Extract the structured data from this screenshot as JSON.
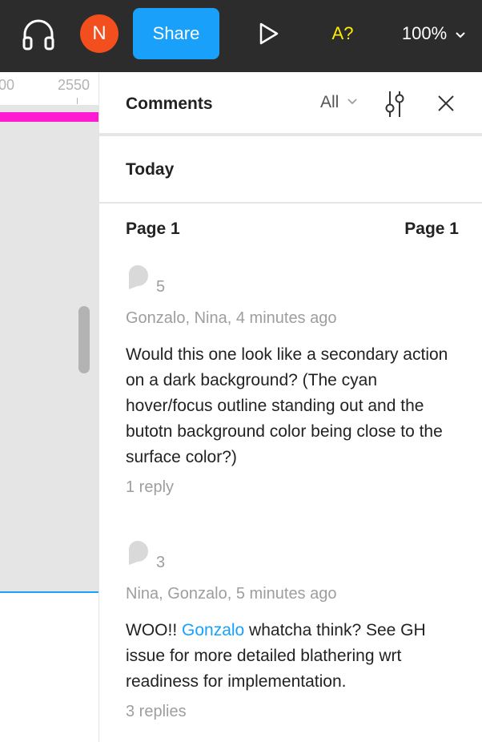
{
  "topbar": {
    "avatar_initial": "N",
    "share_label": "Share",
    "a11y_label": "A?",
    "zoom_label": "100%"
  },
  "canvas": {
    "ruler_labels": [
      "00",
      "2550"
    ],
    "accent_magenta": "#ff1bd1",
    "accent_blue": "#18a0fb"
  },
  "panel": {
    "title": "Comments",
    "filter_label": "All",
    "section": "Today",
    "page_name": "Page 1",
    "page_name_right": "Page 1"
  },
  "comments": [
    {
      "pin_number": "5",
      "authors": "Gonzalo, Nina, 4 minutes ago",
      "text": "Would this one look like a secondary action on a dark background? (The cyan hover/focus outline standing out and the butotn background color being close to the surface color?)",
      "replies": "1 reply"
    },
    {
      "pin_number": "3",
      "authors": "Nina, Gonzalo, 5 minutes ago",
      "text_before": "WOO!! ",
      "mention": "Gonzalo",
      "text_after": " whatcha think? See GH issue for more detailed blathering wrt readiness for implementation.",
      "replies": "3 replies"
    }
  ],
  "colors": {
    "topbar_bg": "#2c2c2c",
    "brand_blue": "#18a0fb",
    "avatar_bg": "#f24e1e",
    "a11y_yellow": "#ffeb00"
  },
  "icons": {
    "headphones": "headphones-icon",
    "play": "play-icon",
    "chevron": "chevron-down-icon",
    "settings": "sliders-icon",
    "close": "close-icon",
    "pin": "comment-pin-icon"
  }
}
